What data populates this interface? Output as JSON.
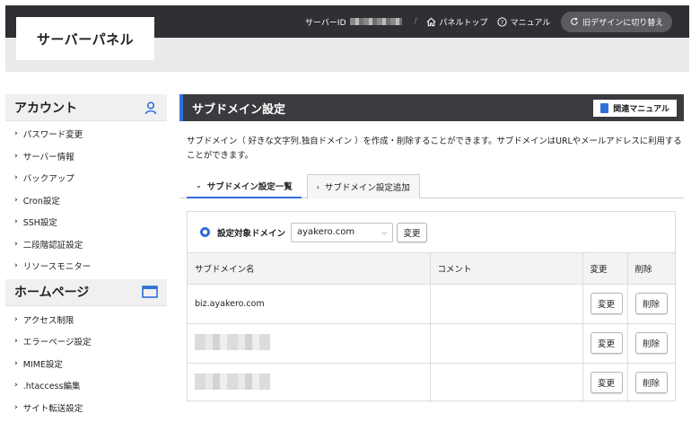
{
  "header": {
    "logo": "サーバーパネル",
    "server_id_label": "サーバーID",
    "nav": [
      {
        "label": "パネルトップ",
        "icon": "home-icon"
      },
      {
        "label": "マニュアル",
        "icon": "help-circle-icon"
      }
    ],
    "old_design_label": "旧デザインに切り替え"
  },
  "sidebar": {
    "sections": [
      {
        "title": "アカウント",
        "icon": "user-icon",
        "items": [
          "パスワード変更",
          "サーバー情報",
          "バックアップ",
          "Cron設定",
          "SSH設定",
          "二段階認証設定",
          "リソースモニター"
        ]
      },
      {
        "title": "ホームページ",
        "icon": "window-icon",
        "items": [
          "アクセス制限",
          "エラーページ設定",
          "MIME設定",
          ".htaccess編集",
          "サイト転送設定"
        ]
      }
    ]
  },
  "main": {
    "title": "サブドメイン設定",
    "manual_button": "関連マニュアル",
    "description": "サブドメイン（ 好きな文字列.独自ドメイン ）を作成・削除することができます。サブドメインはURLやメールアドレスに利用することができます。",
    "tabs": [
      {
        "label": "サブドメイン設定一覧",
        "active": true
      },
      {
        "label": "サブドメイン設定追加",
        "active": false
      }
    ],
    "domain_selector": {
      "label": "設定対象ドメイン",
      "value": "ayakero.com",
      "change_button": "変更"
    },
    "table": {
      "headers": [
        "サブドメイン名",
        "コメント",
        "変更",
        "削除"
      ],
      "rows": [
        {
          "name": "biz.ayakero.com",
          "comment": "",
          "edit": "変更",
          "delete": "削除"
        },
        {
          "name": "",
          "comment": "",
          "edit": "変更",
          "delete": "削除"
        },
        {
          "name": "",
          "comment": "",
          "edit": "変更",
          "delete": "削除"
        }
      ]
    }
  },
  "colors": {
    "header_bg": "#2f3033",
    "accent": "#2f6fdc",
    "section_header_bg": "#3a3b3f"
  }
}
